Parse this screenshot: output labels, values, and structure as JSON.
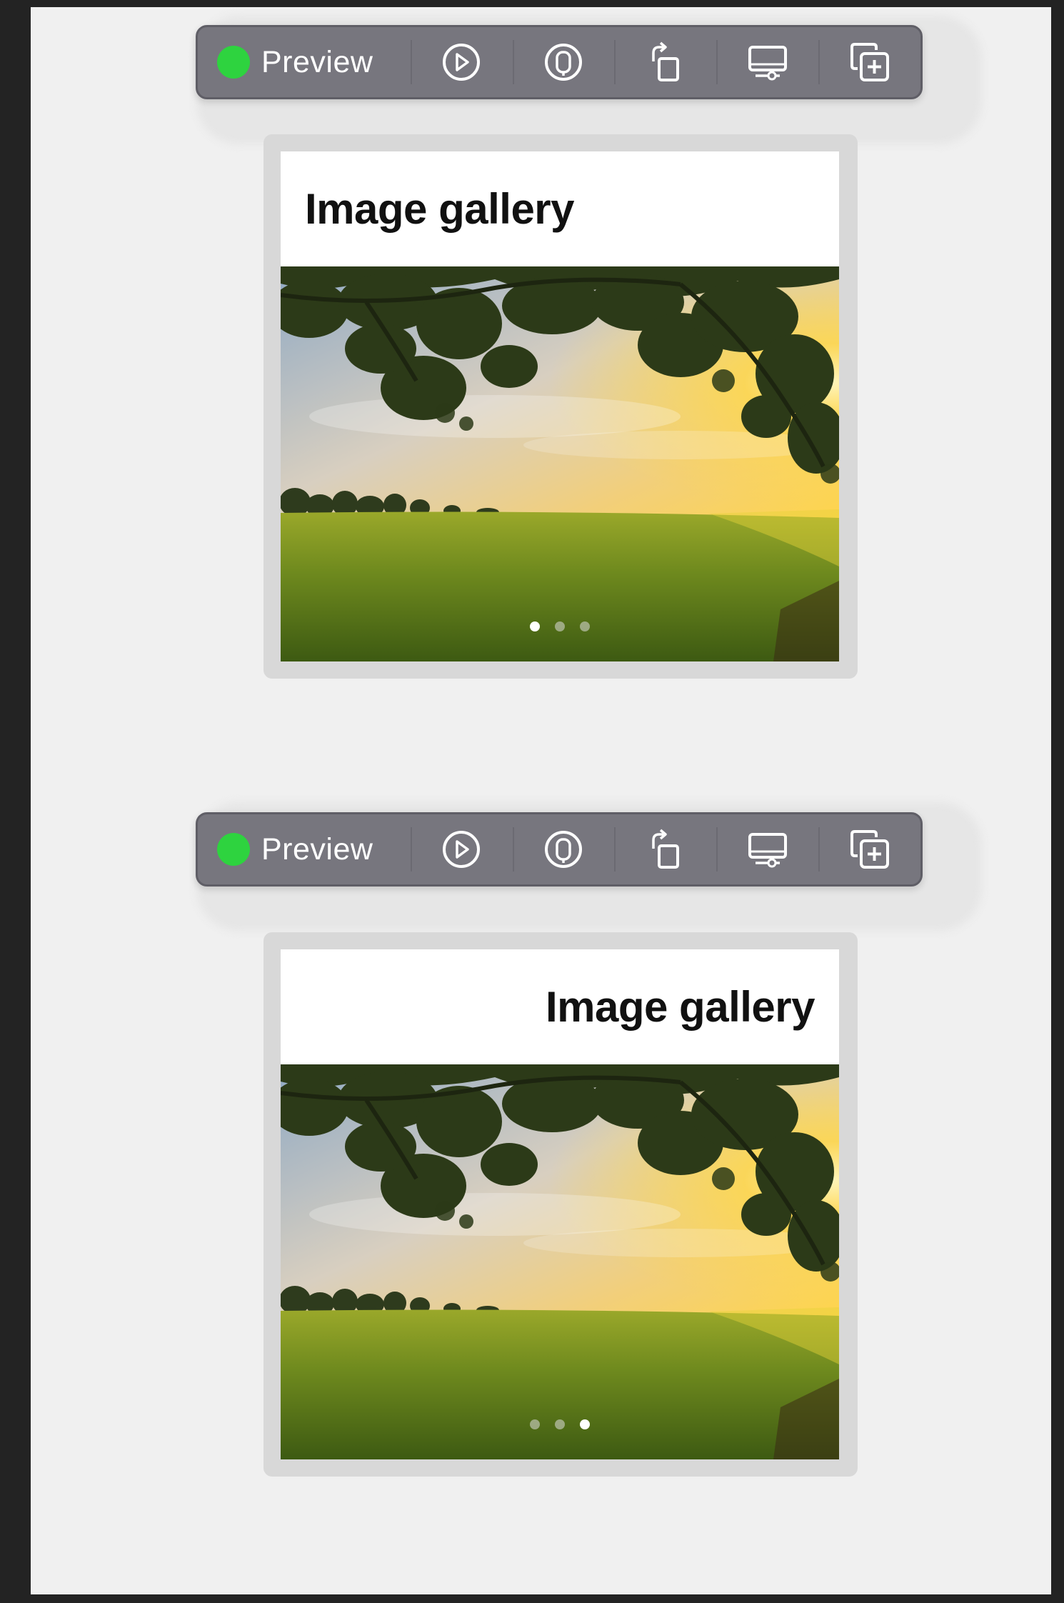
{
  "previews": [
    {
      "toolbar": {
        "label": "Preview",
        "status_color": "#2ed33f",
        "icons": [
          "live-play-icon",
          "variants-icon",
          "rotate-device-icon",
          "device-settings-icon",
          "duplicate-preview-icon"
        ]
      },
      "gallery": {
        "title": "Image gallery",
        "title_alignment": "left",
        "page_count": 3,
        "active_page": 1
      }
    },
    {
      "toolbar": {
        "label": "Preview",
        "status_color": "#2ed33f",
        "icons": [
          "live-play-icon",
          "variants-icon",
          "rotate-device-icon",
          "device-settings-icon",
          "duplicate-preview-icon"
        ]
      },
      "gallery": {
        "title": "Image gallery",
        "title_alignment": "right",
        "page_count": 3,
        "active_page": 3
      }
    }
  ]
}
